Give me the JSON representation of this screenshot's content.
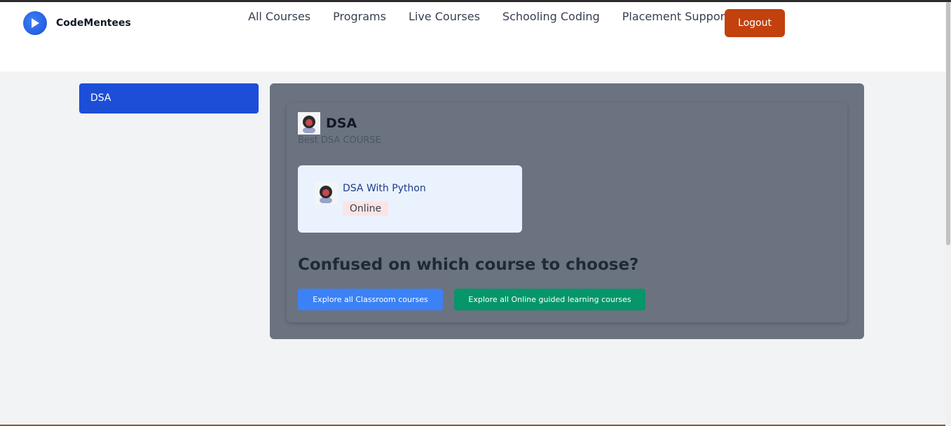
{
  "brand": {
    "name": "CodeMentees",
    "logo_icon": "play-icon",
    "accent": "#1d4ed8"
  },
  "nav": {
    "items": [
      {
        "label": "All Courses"
      },
      {
        "label": "Programs"
      },
      {
        "label": "Live Courses"
      },
      {
        "label": "Schooling Coding"
      },
      {
        "label": "Placement Support"
      }
    ],
    "logout_label": "Logout"
  },
  "sidebar": {
    "items": [
      {
        "label": "DSA",
        "active": true
      }
    ]
  },
  "category": {
    "title": "DSA",
    "subtitle": "Best DSA COURSE",
    "courses": [
      {
        "name": "DSA With Python",
        "mode": "Online"
      }
    ]
  },
  "help": {
    "heading": "Confused on which course to choose?",
    "classroom_button": "Explore all Classroom courses",
    "online_button": "Explore all Online guided learning courses"
  },
  "colors": {
    "logout": "#c2410c",
    "classroom_button": "#3b82f6",
    "online_button": "#059669",
    "panel": "#6b7280"
  }
}
